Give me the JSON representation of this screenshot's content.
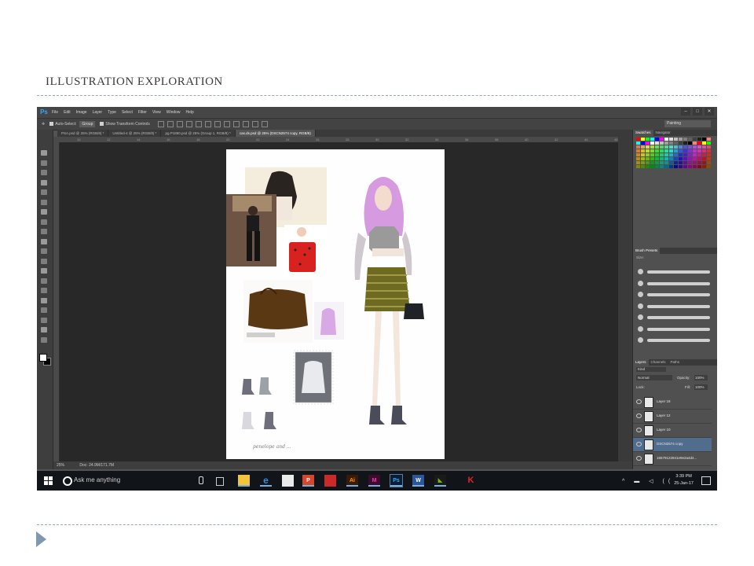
{
  "slide": {
    "title": "ILLUSTRATION EXPLORATION"
  },
  "app": {
    "logo": "Ps",
    "menu": [
      "File",
      "Edit",
      "Image",
      "Layer",
      "Type",
      "Select",
      "Filter",
      "View",
      "Window",
      "Help"
    ],
    "window_controls": [
      "–",
      "□",
      "✕"
    ]
  },
  "options": {
    "auto_select_label": "Auto-Select:",
    "auto_select_value": "Group",
    "transform_label": "Show Transform Controls",
    "workspace": "Painting"
  },
  "tabs": [
    {
      "label": "PSA.psd @ 25% (RGB/8) *",
      "active": false
    },
    {
      "label": "Untitled-4 @ 25% (RGB/8) *",
      "active": false
    },
    {
      "label": "pg.P1890.psd @ 25% (Group 1, RGB/8) *",
      "active": false
    },
    {
      "label": "cas.ds.psd @ 25% (DSCN2574 copy, RGB/8)",
      "active": true
    }
  ],
  "ruler": [
    "10",
    "12",
    "14",
    "16",
    "18",
    "20",
    "22",
    "24",
    "26",
    "28",
    "30",
    "32",
    "34",
    "36",
    "38",
    "40",
    "42",
    "44",
    "46"
  ],
  "status": {
    "zoom": "25%",
    "doc": "Doc: 24.9M/171.7M"
  },
  "panels": {
    "swatch_tabs": [
      "Swatches",
      "Navigator"
    ],
    "brush_tab": "Brush Presets",
    "brush_size_label": "Size:",
    "layer_tabs": [
      "Layers",
      "Channels",
      "Paths"
    ],
    "kind_label": "Kind",
    "blend_mode": "Normal",
    "opacity_label": "Opacity:",
    "opacity_value": "100%",
    "lock_label": "Lock:",
    "fill_label": "Fill:",
    "fill_value": "100%",
    "layers": [
      {
        "name": "Layer 18",
        "selected": false
      },
      {
        "name": "Layer 12",
        "selected": false
      },
      {
        "name": "Layer 10",
        "selected": false
      },
      {
        "name": "DSCN2574 copy",
        "selected": true
      },
      {
        "name": "16579122841e9e2a4d4...",
        "selected": false
      }
    ],
    "swatch_colors": [
      "#ff0000",
      "#ffff00",
      "#00ff00",
      "#00ffff",
      "#0000ff",
      "#ff00ff",
      "#ffffff",
      "#e0e0e0",
      "#c0c0c0",
      "#a0a0a0",
      "#808080",
      "#606060",
      "#404040",
      "#202020",
      "#000000",
      "#ff7f7f"
    ]
  },
  "taskbar": {
    "search_placeholder": "Ask me anything",
    "time": "3:39 PM",
    "date": "25-Jan-17"
  }
}
